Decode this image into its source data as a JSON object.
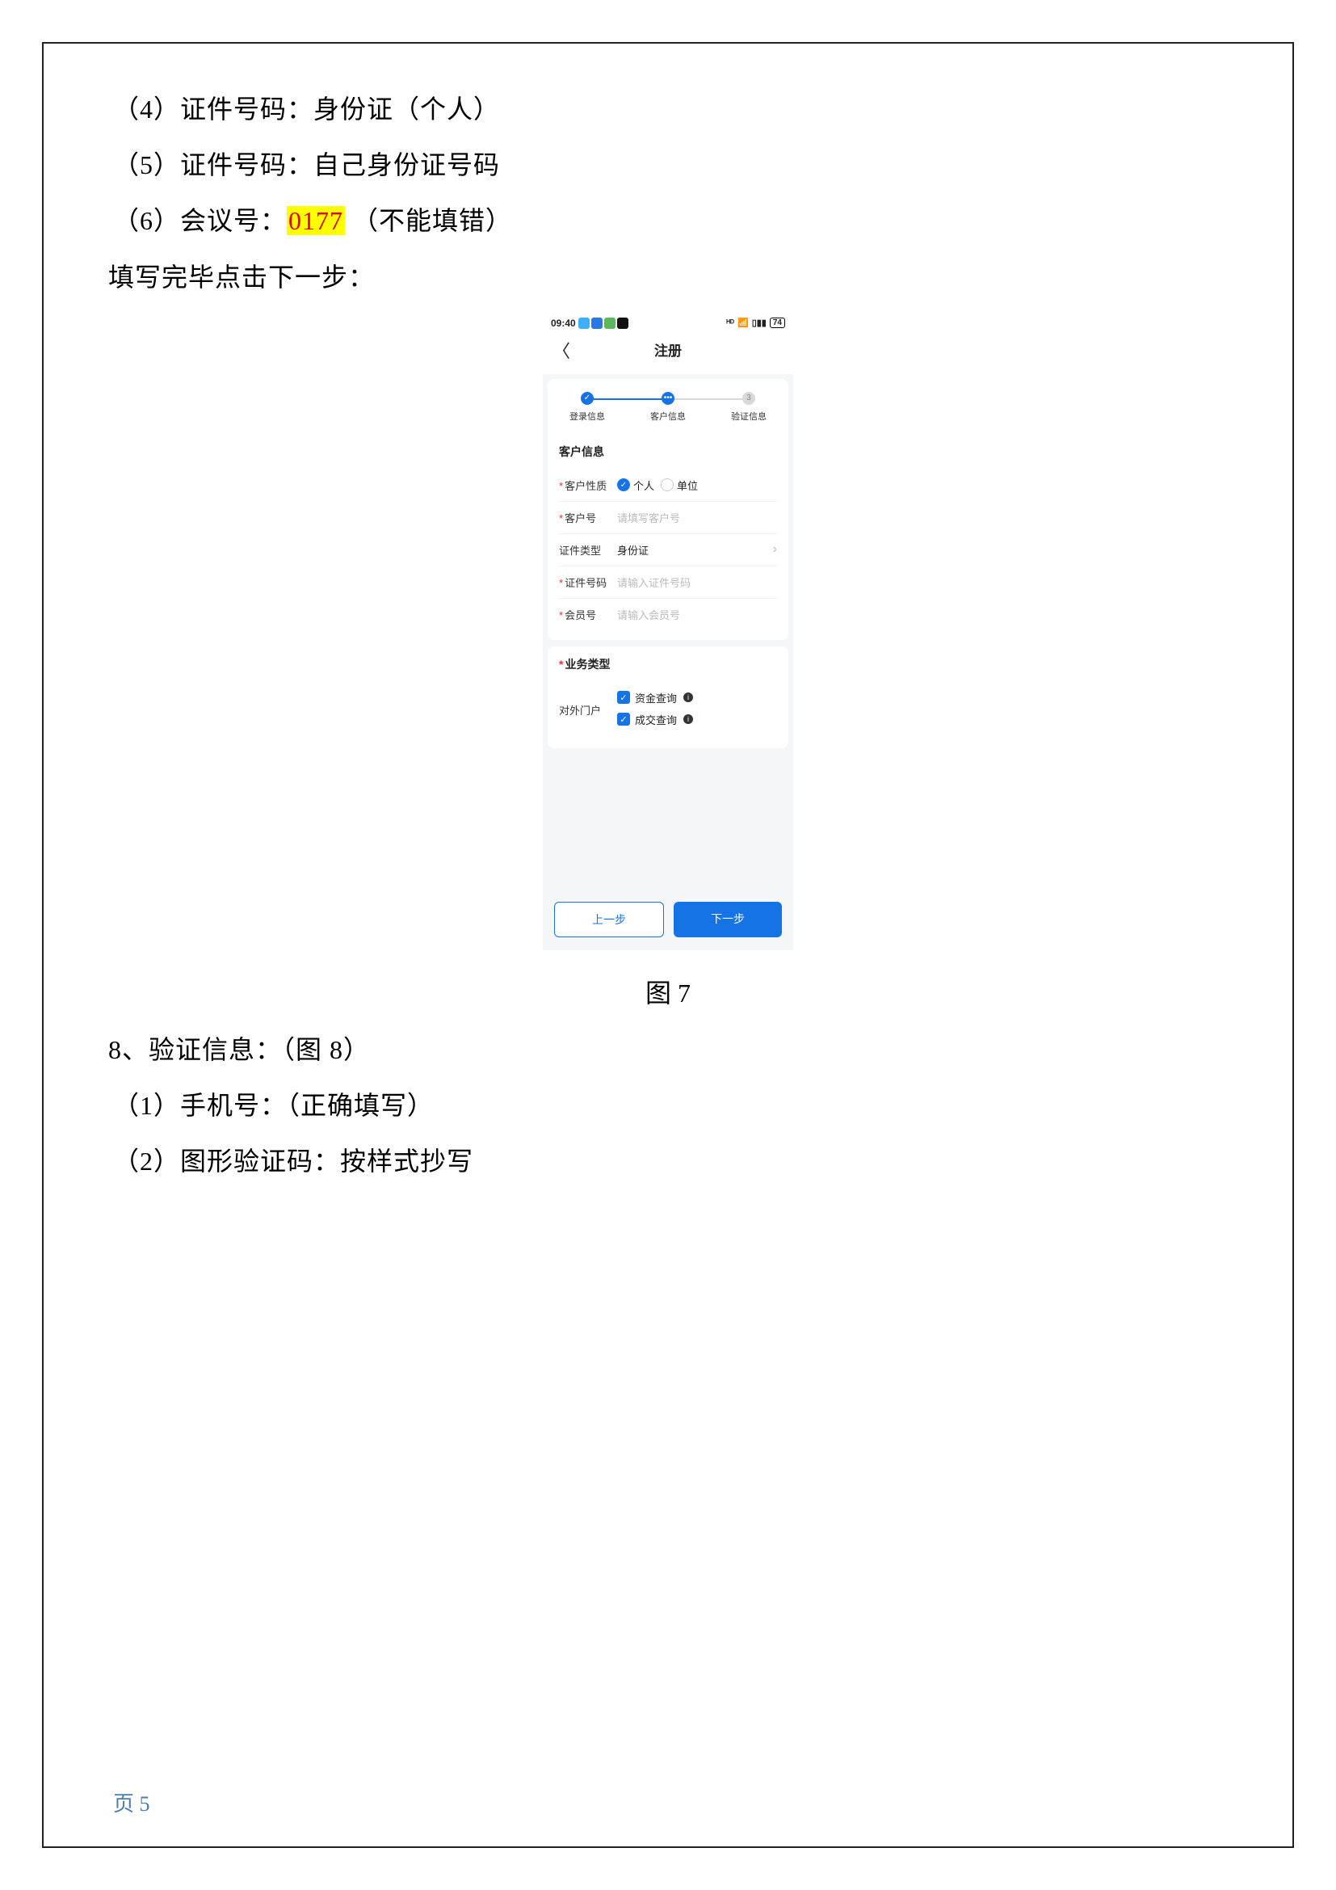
{
  "doc": {
    "line4": "（4）证件号码：身份证（个人）",
    "line5": "（5）证件号码：自己身份证号码",
    "line6_prefix": "（6）会议号：",
    "line6_code": "0177",
    "line6_suffix": " （不能填错）",
    "line_next": "填写完毕点击下一步：",
    "figure_label": "图 7",
    "section8": "8、验证信息：（图 8）",
    "section8_1": "（1）手机号：（正确填写）",
    "section8_2": "（2）图形验证码：按样式抄写",
    "page_number": "页 5"
  },
  "phone": {
    "status": {
      "time": "09:40",
      "icons_colors": [
        "#3cb0ff",
        "#2b78e4",
        "#5bb85b",
        "#111"
      ],
      "right_text": "ᴴᴰ",
      "battery": "74"
    },
    "nav": {
      "title": "注册"
    },
    "steps": [
      {
        "label": "登录信息",
        "state": "done",
        "mark": "✓"
      },
      {
        "label": "客户信息",
        "state": "active",
        "mark": "•••"
      },
      {
        "label": "验证信息",
        "state": "pending",
        "mark": "3"
      }
    ],
    "customer": {
      "section_title": "客户信息",
      "rows": {
        "nature": {
          "label": "客户性质",
          "opt1": "个人",
          "opt2": "单位"
        },
        "custno": {
          "label": "客户号",
          "placeholder": "请填写客户号"
        },
        "idtype": {
          "label": "证件类型",
          "value": "身份证"
        },
        "idno": {
          "label": "证件号码",
          "placeholder": "请输入证件号码"
        },
        "member": {
          "label": "会员号",
          "placeholder": "请输入会员号"
        }
      }
    },
    "biz": {
      "section_title": "业务类型",
      "portal_label": "对外门户",
      "options": [
        "资金查询",
        "成交查询"
      ]
    },
    "buttons": {
      "prev": "上一步",
      "next": "下一步"
    }
  }
}
